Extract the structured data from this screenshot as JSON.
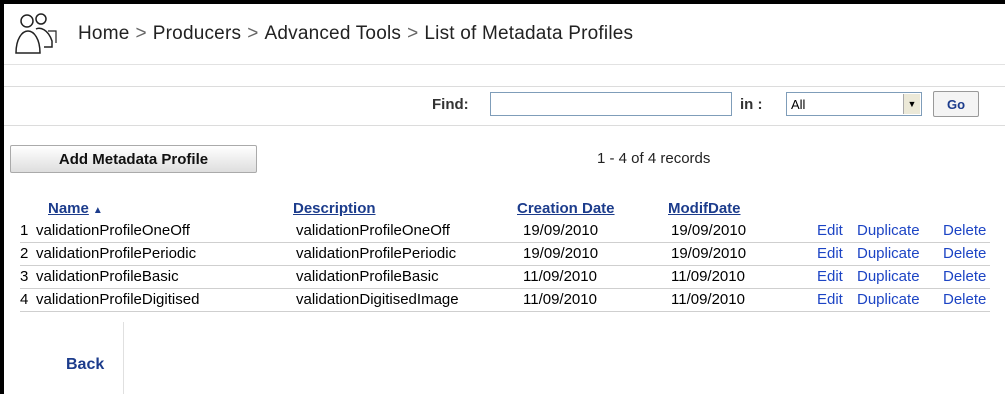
{
  "header": {
    "icon": "users-icon",
    "breadcrumb": [
      "Home",
      "Producers",
      "Advanced Tools",
      "List of Metadata Profiles"
    ],
    "separator": ">"
  },
  "find": {
    "label": "Find:",
    "value": "",
    "in_label": "in :",
    "scope_selected": "All",
    "go_label": "Go"
  },
  "toolbar": {
    "add_label": "Add Metadata Profile",
    "records_text": "1 - 4 of 4 records"
  },
  "table": {
    "columns": [
      "Name",
      "Description",
      "Creation Date",
      "ModifDate"
    ],
    "rows": [
      {
        "num": "1",
        "name": "validationProfileOneOff",
        "description": "validationProfileOneOff",
        "created": "19/09/2010",
        "modified": "19/09/2010"
      },
      {
        "num": "2",
        "name": "validationProfilePeriodic",
        "description": "validationProfilePeriodic",
        "created": "19/09/2010",
        "modified": "19/09/2010"
      },
      {
        "num": "3",
        "name": "validationProfileBasic",
        "description": "validationProfileBasic",
        "created": "11/09/2010",
        "modified": "11/09/2010"
      },
      {
        "num": "4",
        "name": "validationProfileDigitised",
        "description": "validationDigitisedImage",
        "created": "11/09/2010",
        "modified": "11/09/2010"
      }
    ],
    "actions": {
      "edit": "Edit",
      "duplicate": "Duplicate",
      "delete": "Delete"
    }
  },
  "footer": {
    "back_label": "Back"
  },
  "colors": {
    "link": "#1c3c8c",
    "action": "#1c44c4"
  }
}
